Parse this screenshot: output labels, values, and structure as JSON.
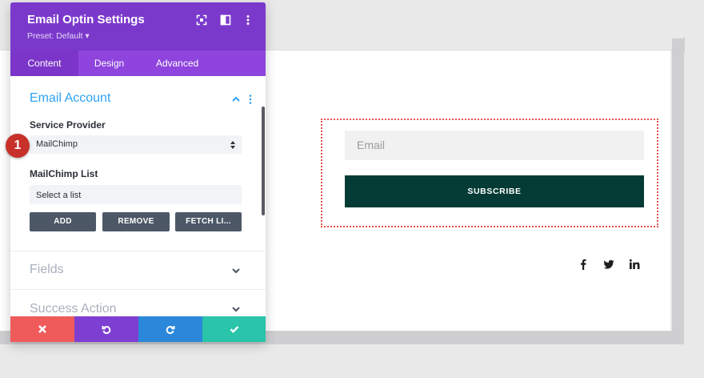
{
  "panel": {
    "title": "Email Optin Settings",
    "preset": "Preset: Default ▾",
    "tabs": [
      {
        "label": "Content",
        "active": true
      },
      {
        "label": "Design",
        "active": false
      },
      {
        "label": "Advanced",
        "active": false
      }
    ],
    "email_account": {
      "title": "Email Account",
      "service_provider_label": "Service Provider",
      "service_provider_value": "MailChimp",
      "list_label": "MailChimp List",
      "list_value": "Select a list",
      "buttons": {
        "add": "ADD",
        "remove": "REMOVE",
        "fetch": "FETCH LI..."
      }
    },
    "sections": [
      {
        "title": "Fields"
      },
      {
        "title": "Success Action"
      }
    ]
  },
  "step_badge": "1",
  "preview": {
    "email_placeholder": "Email",
    "subscribe_label": "SUBSCRIBE",
    "social_icons": [
      "facebook-icon",
      "twitter-icon",
      "linkedin-icon"
    ]
  },
  "colors": {
    "panel_header": "#7b39cc",
    "tab_bar": "#8e44dd",
    "accent_blue": "#2ea3f2",
    "subscribe_bg": "#043b35",
    "cancel": "#ef5b5b",
    "undo": "#7d3fd1",
    "redo": "#2b87da",
    "save": "#29c4a9",
    "badge": "#c8302a"
  }
}
